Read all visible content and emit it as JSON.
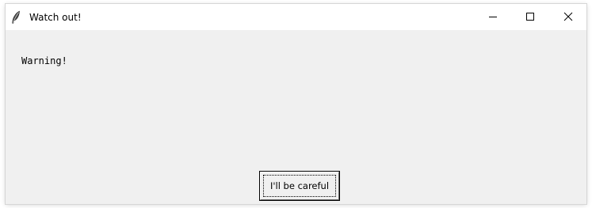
{
  "window": {
    "title": "Watch out!",
    "icon": "feather-icon",
    "controls": {
      "minimize": "minimize-icon",
      "maximize": "maximize-icon",
      "close": "close-icon"
    }
  },
  "dialog": {
    "message": "Warning!",
    "button_label": "I'll be careful"
  }
}
